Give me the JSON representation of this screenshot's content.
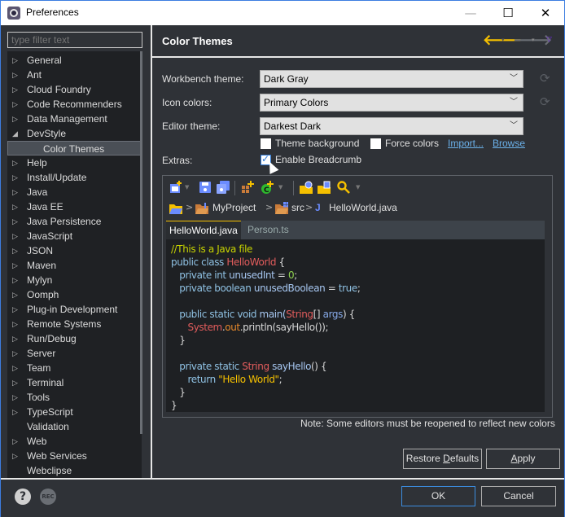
{
  "window": {
    "title": "Preferences",
    "minimize": "—",
    "maximize": "☐",
    "close": "✕"
  },
  "sidebar": {
    "filter_placeholder": "type filter text",
    "items": [
      {
        "label": "General",
        "expander": "▷",
        "level": 0
      },
      {
        "label": "Ant",
        "expander": "▷",
        "level": 0
      },
      {
        "label": "Cloud Foundry",
        "expander": "▷",
        "level": 0
      },
      {
        "label": "Code Recommenders",
        "expander": "▷",
        "level": 0
      },
      {
        "label": "Data Management",
        "expander": "▷",
        "level": 0
      },
      {
        "label": "DevStyle",
        "expander": "◢",
        "level": 0
      },
      {
        "label": "Color Themes",
        "expander": "",
        "level": 1,
        "selected": true
      },
      {
        "label": "Help",
        "expander": "▷",
        "level": 0
      },
      {
        "label": "Install/Update",
        "expander": "▷",
        "level": 0
      },
      {
        "label": "Java",
        "expander": "▷",
        "level": 0
      },
      {
        "label": "Java EE",
        "expander": "▷",
        "level": 0
      },
      {
        "label": "Java Persistence",
        "expander": "▷",
        "level": 0
      },
      {
        "label": "JavaScript",
        "expander": "▷",
        "level": 0
      },
      {
        "label": "JSON",
        "expander": "▷",
        "level": 0
      },
      {
        "label": "Maven",
        "expander": "▷",
        "level": 0
      },
      {
        "label": "Mylyn",
        "expander": "▷",
        "level": 0
      },
      {
        "label": "Oomph",
        "expander": "▷",
        "level": 0
      },
      {
        "label": "Plug-in Development",
        "expander": "▷",
        "level": 0
      },
      {
        "label": "Remote Systems",
        "expander": "▷",
        "level": 0
      },
      {
        "label": "Run/Debug",
        "expander": "▷",
        "level": 0
      },
      {
        "label": "Server",
        "expander": "▷",
        "level": 0
      },
      {
        "label": "Team",
        "expander": "▷",
        "level": 0
      },
      {
        "label": "Terminal",
        "expander": "▷",
        "level": 0
      },
      {
        "label": "Tools",
        "expander": "▷",
        "level": 0
      },
      {
        "label": "TypeScript",
        "expander": "▷",
        "level": 0
      },
      {
        "label": "Validation",
        "expander": "",
        "level": 0
      },
      {
        "label": "Web",
        "expander": "▷",
        "level": 0
      },
      {
        "label": "Web Services",
        "expander": "▷",
        "level": 0
      },
      {
        "label": "Webclipse",
        "expander": "",
        "level": 0
      }
    ]
  },
  "page": {
    "title": "Color Themes",
    "nav": {
      "back": "🡐",
      "forward": "🡒",
      "dropdown": "▾",
      "menu": "▽"
    },
    "fields": {
      "workbench_label": "Workbench theme:",
      "workbench_value": "Dark Gray",
      "icon_label": "Icon colors:",
      "icon_value": "Primary Colors",
      "editor_label": "Editor theme:",
      "editor_value": "Darkest Dark",
      "chevron": "﹀",
      "refresh": "⟳"
    },
    "options": {
      "theme_background": {
        "label": "Theme background",
        "checked": false
      },
      "force_colors": {
        "label": "Force colors",
        "checked": false
      },
      "import_link": "Import...",
      "browse_link": "Browse",
      "extras_label": "Extras:",
      "enable_breadcrumb": {
        "label": "Enable Breadcrumb",
        "checked": true
      }
    },
    "preview": {
      "breadcrumb": {
        "project": "MyProject",
        "folder": "src",
        "file": "HelloWorld.java",
        "separator": ">",
        "java_icon": "J"
      },
      "tabs": [
        {
          "label": "HelloWorld.java",
          "active": true
        },
        {
          "label": "Person.ts",
          "active": false
        }
      ],
      "code": [
        [
          {
            "t": "//This is a Java file",
            "c": "comment"
          }
        ],
        [
          {
            "t": "public class ",
            "c": "kw"
          },
          {
            "t": "HelloWorld",
            "c": "type"
          },
          {
            "t": " {",
            "c": "plain"
          }
        ],
        [
          {
            "t": "   private int ",
            "c": "kw"
          },
          {
            "t": "unusedInt",
            "c": "method"
          },
          {
            "t": " = ",
            "c": "plain"
          },
          {
            "t": "0",
            "c": "num"
          },
          {
            "t": ";",
            "c": "plain"
          }
        ],
        [
          {
            "t": "   private boolean ",
            "c": "kw"
          },
          {
            "t": "unusedBoolean",
            "c": "method"
          },
          {
            "t": " = ",
            "c": "plain"
          },
          {
            "t": "true",
            "c": "kw"
          },
          {
            "t": ";",
            "c": "plain"
          }
        ],
        [],
        [
          {
            "t": "   public static void ",
            "c": "kw"
          },
          {
            "t": "main(",
            "c": "method"
          },
          {
            "t": "String",
            "c": "type"
          },
          {
            "t": "[] ",
            "c": "plain"
          },
          {
            "t": "args",
            "c": "param"
          },
          {
            "t": ") {",
            "c": "plain"
          }
        ],
        [
          {
            "t": "      ",
            "c": "plain"
          },
          {
            "t": "System",
            "c": "type"
          },
          {
            "t": ".",
            "c": "plain"
          },
          {
            "t": "out",
            "c": "field"
          },
          {
            "t": ".println(sayHello());",
            "c": "plain"
          }
        ],
        [
          {
            "t": "   }",
            "c": "plain"
          }
        ],
        [],
        [
          {
            "t": "   private static ",
            "c": "kw"
          },
          {
            "t": "String",
            "c": "type"
          },
          {
            "t": " sayHello",
            "c": "method"
          },
          {
            "t": "() {",
            "c": "plain"
          }
        ],
        [
          {
            "t": "      return ",
            "c": "kw"
          },
          {
            "t": "\"Hello World\"",
            "c": "str"
          },
          {
            "t": ";",
            "c": "plain"
          }
        ],
        [
          {
            "t": "   }",
            "c": "plain"
          }
        ],
        [
          {
            "t": "}",
            "c": "plain"
          }
        ]
      ]
    },
    "note": "Note: Some editors must be reopened to reflect new colors",
    "restore_defaults": {
      "pre": "Restore ",
      "mnemonic": "D",
      "post": "efaults"
    },
    "apply": {
      "pre": "",
      "mnemonic": "A",
      "post": "pply"
    }
  },
  "footer": {
    "help_icon": "?",
    "rec_icon": "REC",
    "ok": "OK",
    "cancel": "Cancel"
  },
  "colors": {
    "accent_yellow": "#f5c000",
    "focus_blue": "#3c8de0",
    "link": "#6bb1ea"
  }
}
